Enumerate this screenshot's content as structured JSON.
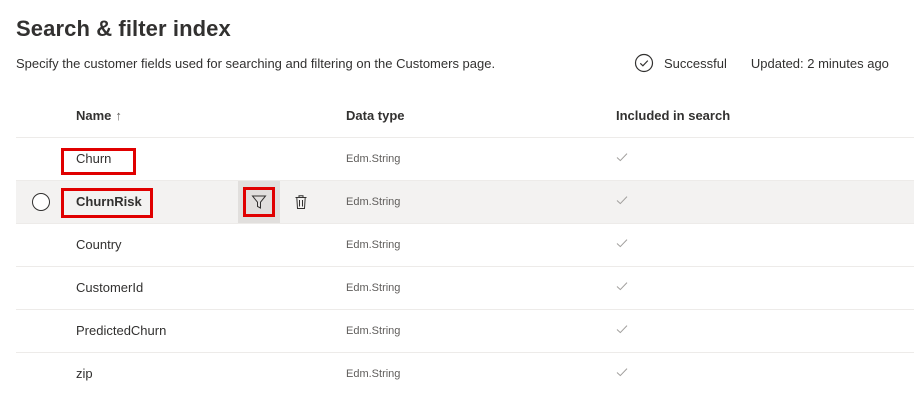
{
  "page": {
    "title": "Search & filter index",
    "description": "Specify the customer fields used for searching and filtering on the Customers page."
  },
  "status": {
    "state": "Successful",
    "updated": "Updated: 2 minutes ago",
    "icon": "check-circle-icon"
  },
  "table": {
    "headers": {
      "name": "Name",
      "sort_indicator": "↑",
      "data_type": "Data type",
      "included": "Included in search"
    },
    "rows": [
      {
        "name": "Churn",
        "data_type": "Edm.String",
        "included": true
      },
      {
        "name": "ChurnRisk",
        "data_type": "Edm.String",
        "included": true,
        "selected": true
      },
      {
        "name": "Country",
        "data_type": "Edm.String",
        "included": true
      },
      {
        "name": "CustomerId",
        "data_type": "Edm.String",
        "included": true
      },
      {
        "name": "PredictedChurn",
        "data_type": "Edm.String",
        "included": true
      },
      {
        "name": "zip",
        "data_type": "Edm.String",
        "included": true
      }
    ]
  },
  "actions": {
    "filter_icon": "filter-icon",
    "delete_icon": "trash-icon"
  },
  "colors": {
    "highlight": "#e00000",
    "row_border": "#edebe9",
    "selected_row": "#f3f2f1",
    "check": "#a19f9d"
  }
}
